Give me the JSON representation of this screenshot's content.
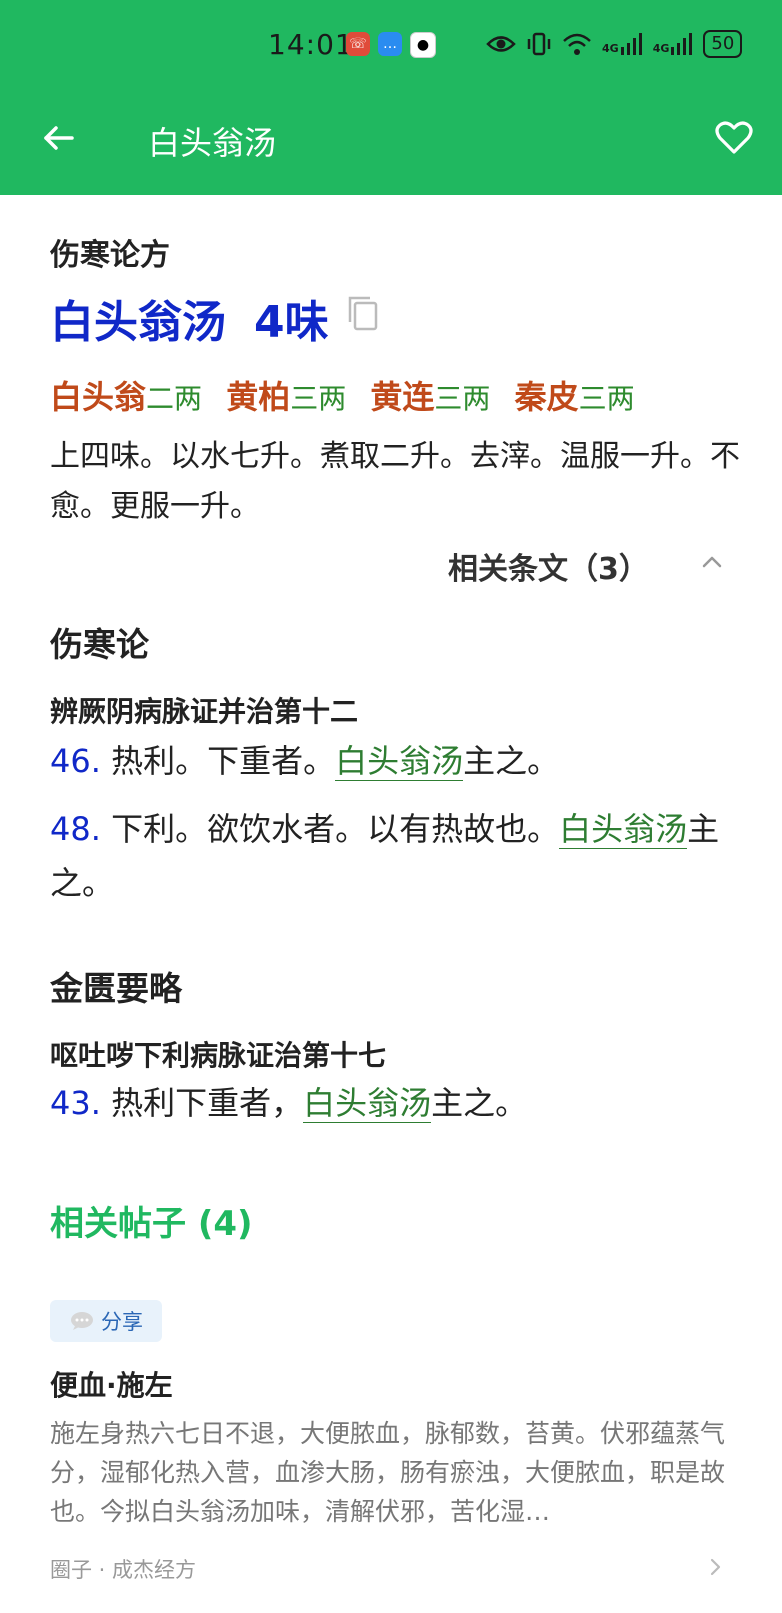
{
  "status_bar": {
    "time": "14:01",
    "battery": "50",
    "network_labels": [
      "4G",
      "4G"
    ],
    "app_icons": [
      "missed-call-icon",
      "message-icon",
      "qq-icon"
    ],
    "system_icons": [
      "eye-icon",
      "vibrate-icon",
      "wifi-icon",
      "signal-icon",
      "signal-icon",
      "battery-icon"
    ]
  },
  "app_bar": {
    "title": "白头翁汤",
    "back_icon": "arrow-left-icon",
    "favorite_icon": "heart-icon",
    "color": "#20b860"
  },
  "formula": {
    "source": "伤寒论方",
    "name": "白头翁汤",
    "count": "4味",
    "herbs": [
      {
        "name": "白头翁",
        "dose": "二两"
      },
      {
        "name": "黄柏",
        "dose": "三两"
      },
      {
        "name": "黄连",
        "dose": "三两"
      },
      {
        "name": "秦皮",
        "dose": "三两"
      }
    ],
    "directions": "上四味。以水七升。煮取二升。去滓。温服一升。不愈。更服一升。",
    "related_toggle": "相关条文（3）"
  },
  "books": [
    {
      "title": "伤寒论",
      "chapter": "辨厥阴病脉证并治第十二",
      "clauses": [
        {
          "num": "46.",
          "before": " 热利。下重者。",
          "link": "白头翁汤",
          "after": "主之。"
        },
        {
          "num": "48.",
          "before": " 下利。欲饮水者。以有热故也。",
          "link": "白头翁汤",
          "after": "主之。"
        }
      ]
    },
    {
      "title": "金匮要略",
      "chapter": "呕吐哕下利病脉证治第十七",
      "clauses": [
        {
          "num": "43.",
          "before": " 热利下重者，",
          "link": "白头翁汤",
          "after": "主之。"
        }
      ]
    }
  ],
  "posts": {
    "heading": "相关帖子 (4)",
    "items": [
      {
        "tag": "分享",
        "title": "便血·施左",
        "excerpt": "施左身热六七日不退，大便脓血，脉郁数，苔黄。伏邪蕴蒸气分，湿郁化热入营，血渗大肠，肠有瘀浊，大便脓血，职是故也。今拟白头翁汤加味，清解伏邪，苦化湿…",
        "meta": "圈子 · 成杰经方"
      }
    ]
  }
}
